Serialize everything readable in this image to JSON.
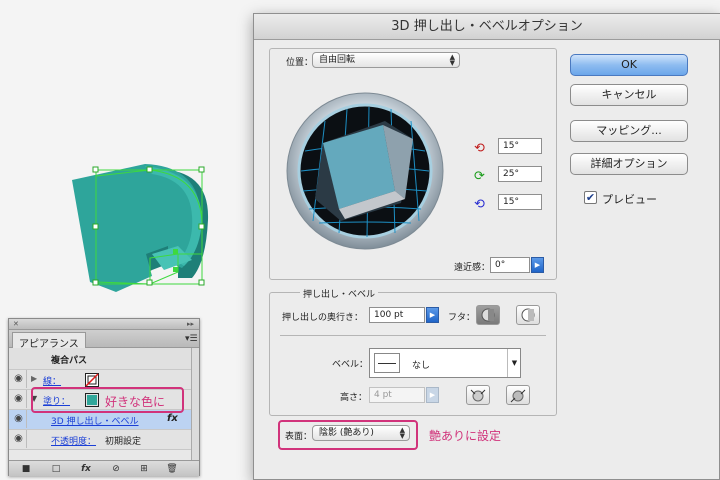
{
  "appearance": {
    "tab": "アピアランス",
    "header": "複合パス",
    "stroke_label": "線：",
    "fill_label": "塗り：",
    "effect_label": "3D 押し出し・ベベル",
    "effect_fx": "fx",
    "opacity_label": "不透明度：",
    "opacity_value": "初期設定",
    "callout": "好きな色に",
    "fill_color": "#31a79a"
  },
  "dialog": {
    "title": "3D 押し出し・ベベルオプション",
    "position_label": "位置：",
    "position_value": "自由回転",
    "rot_x": "15°",
    "rot_y": "25°",
    "rot_z": "15°",
    "perspective_label": "遠近感：",
    "perspective_value": "0°",
    "extrude_section": "押し出し・ベベル",
    "depth_label": "押し出しの奥行き：",
    "depth_value": "100 pt",
    "cap_label": "フタ：",
    "bevel_label": "ベベル：",
    "bevel_value": "なし",
    "height_label": "高さ：",
    "height_value": "4 pt",
    "surface_label": "表面：",
    "surface_value": "陰影 (艶あり)",
    "surface_callout": "艶ありに設定",
    "ok": "OK",
    "cancel": "キャンセル",
    "mapping": "マッピング...",
    "more_options": "詳細オプション",
    "preview_label": "プレビュー",
    "preview_checked": true
  },
  "colors": {
    "accent": "#d1337b",
    "shape_fill": "#2a9b92",
    "selection": "#3ed93e"
  }
}
